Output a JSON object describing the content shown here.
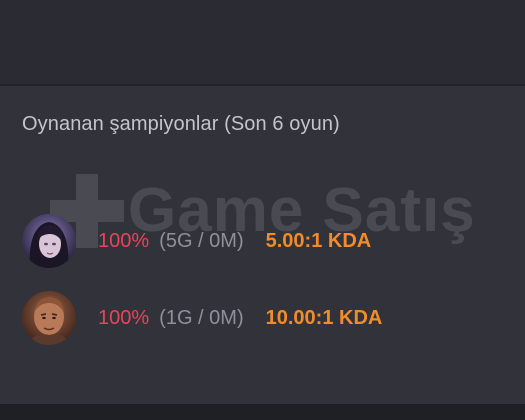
{
  "section": {
    "title": "Oynanan şampiyonlar (Son 6 oyun)"
  },
  "watermark": {
    "text": "Game Satış",
    "icon": "plus-logo-icon"
  },
  "champions": [
    {
      "avatar_icon": "champion-portrait-dark-haired-icon",
      "win_rate": "100%",
      "games": "(5G / 0M)",
      "kda": "5.00:1 KDA"
    },
    {
      "avatar_icon": "champion-portrait-bald-warrior-icon",
      "win_rate": "100%",
      "games": "(1G / 0M)",
      "kda": "10.00:1 KDA"
    }
  ],
  "colors": {
    "background": "#31323a",
    "win_rate": "#e8445a",
    "games": "#8f909a",
    "kda": "#f28c28",
    "title": "#c3c4cc"
  }
}
